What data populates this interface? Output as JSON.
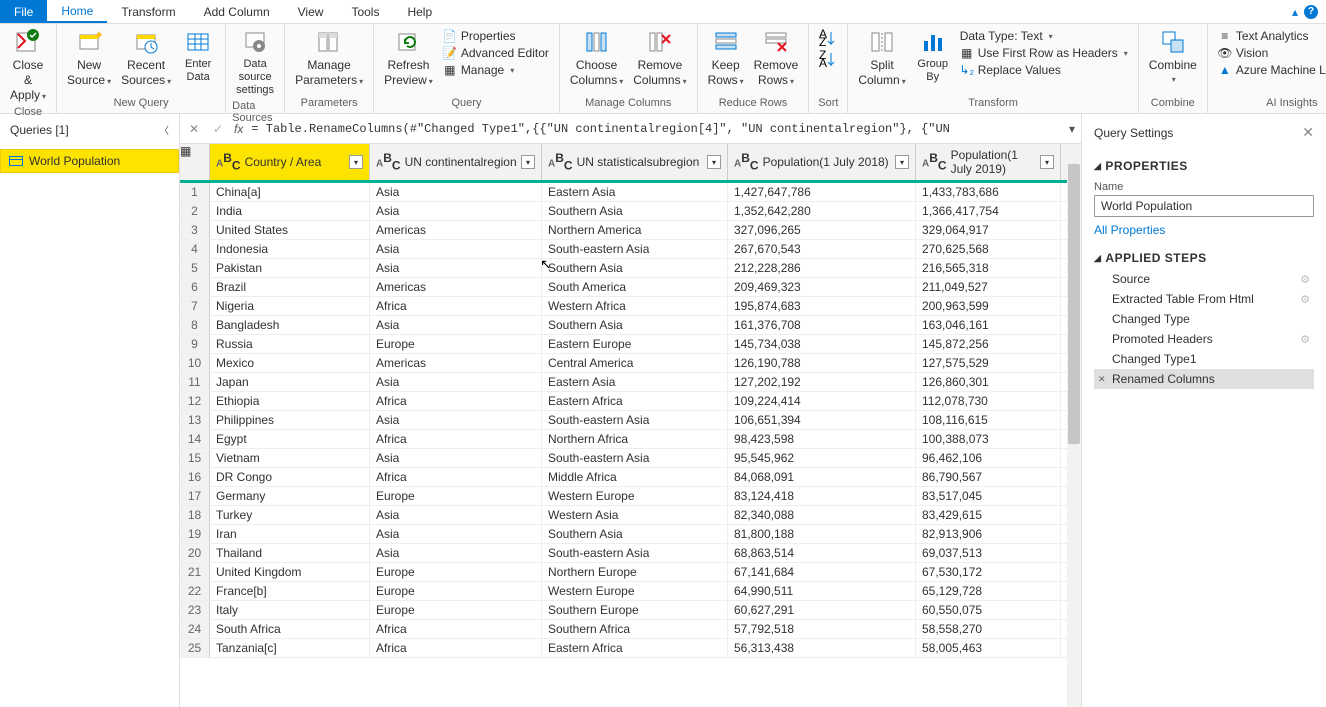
{
  "menu": {
    "file": "File",
    "home": "Home",
    "transform": "Transform",
    "addcol": "Add Column",
    "view": "View",
    "tools": "Tools",
    "help": "Help"
  },
  "ribbon": {
    "close": {
      "close_apply": "Close &\nApply",
      "group": "Close"
    },
    "newquery": {
      "new_source": "New\nSource",
      "recent": "Recent\nSources",
      "enter": "Enter\nData",
      "group": "New Query"
    },
    "datasources": {
      "settings": "Data source\nsettings",
      "group": "Data Sources"
    },
    "params": {
      "manage": "Manage\nParameters",
      "group": "Parameters"
    },
    "query": {
      "refresh": "Refresh\nPreview",
      "properties": "Properties",
      "adv": "Advanced Editor",
      "manage": "Manage",
      "group": "Query"
    },
    "managecols": {
      "choose": "Choose\nColumns",
      "remove": "Remove\nColumns",
      "group": "Manage Columns"
    },
    "reducerows": {
      "keep": "Keep\nRows",
      "remove": "Remove\nRows",
      "group": "Reduce Rows"
    },
    "sort": {
      "group": "Sort"
    },
    "transform": {
      "split": "Split\nColumn",
      "groupby": "Group\nBy",
      "datatype": "Data Type: Text",
      "firstrow": "Use First Row as Headers",
      "replace": "Replace Values",
      "group": "Transform"
    },
    "combine": {
      "combine": "Combine",
      "group": "Combine"
    },
    "ai": {
      "text": "Text Analytics",
      "vision": "Vision",
      "ml": "Azure Machine Learning",
      "group": "AI Insights"
    }
  },
  "queries": {
    "title": "Queries [1]",
    "item": "World Population"
  },
  "formula": "= Table.RenameColumns(#\"Changed Type1\",{{\"UN continentalregion[4]\", \"UN continentalregion\"}, {\"UN",
  "columns": [
    "Country / Area",
    "UN continentalregion",
    "UN statisticalsubregion",
    "Population(1 July 2018)",
    "Population(1 July 2019)"
  ],
  "rows": [
    [
      "China[a]",
      "Asia",
      "Eastern Asia",
      "1,427,647,786",
      "1,433,783,686"
    ],
    [
      "India",
      "Asia",
      "Southern Asia",
      "1,352,642,280",
      "1,366,417,754"
    ],
    [
      "United States",
      "Americas",
      "Northern America",
      "327,096,265",
      "329,064,917"
    ],
    [
      "Indonesia",
      "Asia",
      "South-eastern Asia",
      "267,670,543",
      "270,625,568"
    ],
    [
      "Pakistan",
      "Asia",
      "Southern Asia",
      "212,228,286",
      "216,565,318"
    ],
    [
      "Brazil",
      "Americas",
      "South America",
      "209,469,323",
      "211,049,527"
    ],
    [
      "Nigeria",
      "Africa",
      "Western Africa",
      "195,874,683",
      "200,963,599"
    ],
    [
      "Bangladesh",
      "Asia",
      "Southern Asia",
      "161,376,708",
      "163,046,161"
    ],
    [
      "Russia",
      "Europe",
      "Eastern Europe",
      "145,734,038",
      "145,872,256"
    ],
    [
      "Mexico",
      "Americas",
      "Central America",
      "126,190,788",
      "127,575,529"
    ],
    [
      "Japan",
      "Asia",
      "Eastern Asia",
      "127,202,192",
      "126,860,301"
    ],
    [
      "Ethiopia",
      "Africa",
      "Eastern Africa",
      "109,224,414",
      "112,078,730"
    ],
    [
      "Philippines",
      "Asia",
      "South-eastern Asia",
      "106,651,394",
      "108,116,615"
    ],
    [
      "Egypt",
      "Africa",
      "Northern Africa",
      "98,423,598",
      "100,388,073"
    ],
    [
      "Vietnam",
      "Asia",
      "South-eastern Asia",
      "95,545,962",
      "96,462,106"
    ],
    [
      "DR Congo",
      "Africa",
      "Middle Africa",
      "84,068,091",
      "86,790,567"
    ],
    [
      "Germany",
      "Europe",
      "Western Europe",
      "83,124,418",
      "83,517,045"
    ],
    [
      "Turkey",
      "Asia",
      "Western Asia",
      "82,340,088",
      "83,429,615"
    ],
    [
      "Iran",
      "Asia",
      "Southern Asia",
      "81,800,188",
      "82,913,906"
    ],
    [
      "Thailand",
      "Asia",
      "South-eastern Asia",
      "68,863,514",
      "69,037,513"
    ],
    [
      "United Kingdom",
      "Europe",
      "Northern Europe",
      "67,141,684",
      "67,530,172"
    ],
    [
      "France[b]",
      "Europe",
      "Western Europe",
      "64,990,511",
      "65,129,728"
    ],
    [
      "Italy",
      "Europe",
      "Southern Europe",
      "60,627,291",
      "60,550,075"
    ],
    [
      "South Africa",
      "Africa",
      "Southern Africa",
      "57,792,518",
      "58,558,270"
    ],
    [
      "Tanzania[c]",
      "Africa",
      "Eastern Africa",
      "56,313,438",
      "58,005,463"
    ]
  ],
  "settings": {
    "title": "Query Settings",
    "properties": "PROPERTIES",
    "name_lbl": "Name",
    "name_val": "World Population",
    "all_props": "All Properties",
    "applied": "APPLIED STEPS",
    "steps": [
      "Source",
      "Extracted Table From Html",
      "Changed Type",
      "Promoted Headers",
      "Changed Type1",
      "Renamed Columns"
    ],
    "gear_steps": [
      0,
      1,
      3
    ]
  }
}
